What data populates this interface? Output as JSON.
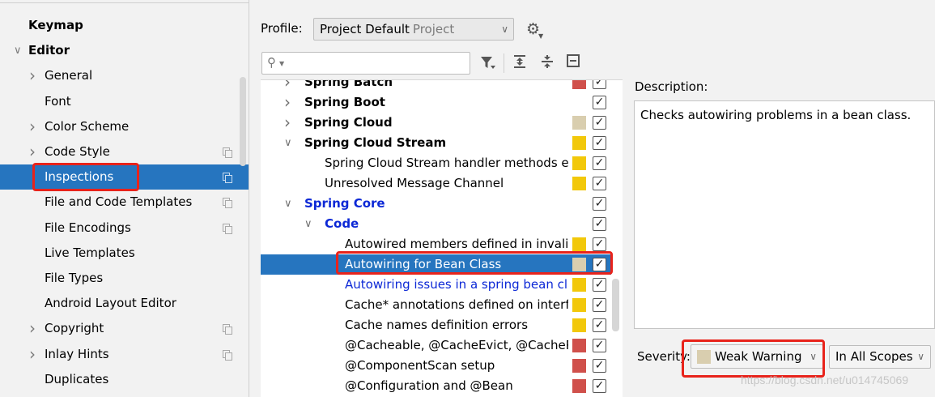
{
  "sidebar": {
    "items": [
      {
        "label": "Keymap",
        "bold": true,
        "indent": 0,
        "chevron": "",
        "copy": false
      },
      {
        "label": "Editor",
        "bold": true,
        "indent": 0,
        "chevron": "down",
        "copy": false
      },
      {
        "label": "General",
        "bold": false,
        "indent": 1,
        "chevron": "right",
        "copy": false
      },
      {
        "label": "Font",
        "bold": false,
        "indent": 1,
        "chevron": "",
        "copy": false
      },
      {
        "label": "Color Scheme",
        "bold": false,
        "indent": 1,
        "chevron": "right",
        "copy": false
      },
      {
        "label": "Code Style",
        "bold": false,
        "indent": 1,
        "chevron": "right",
        "copy": true
      },
      {
        "label": "Inspections",
        "bold": false,
        "indent": 1,
        "chevron": "",
        "copy": true,
        "selected": true
      },
      {
        "label": "File and Code Templates",
        "bold": false,
        "indent": 1,
        "chevron": "",
        "copy": true
      },
      {
        "label": "File Encodings",
        "bold": false,
        "indent": 1,
        "chevron": "",
        "copy": true
      },
      {
        "label": "Live Templates",
        "bold": false,
        "indent": 1,
        "chevron": "",
        "copy": false
      },
      {
        "label": "File Types",
        "bold": false,
        "indent": 1,
        "chevron": "",
        "copy": false
      },
      {
        "label": "Android Layout Editor",
        "bold": false,
        "indent": 1,
        "chevron": "",
        "copy": false
      },
      {
        "label": "Copyright",
        "bold": false,
        "indent": 1,
        "chevron": "right",
        "copy": true
      },
      {
        "label": "Inlay Hints",
        "bold": false,
        "indent": 1,
        "chevron": "right",
        "copy": true
      },
      {
        "label": "Duplicates",
        "bold": false,
        "indent": 1,
        "chevron": "",
        "copy": false
      }
    ]
  },
  "profile": {
    "label": "Profile:",
    "value": "Project Default",
    "value_suffix": "Project",
    "gear_icon": "gear-icon"
  },
  "toolbar": {
    "search_placeholder": "",
    "icons": [
      "filter-icon",
      "expand-all-icon",
      "collapse-all-icon",
      "reset-icon"
    ]
  },
  "tree": {
    "rows": [
      {
        "label": "Spring Batch",
        "style": "bold",
        "level": 0,
        "chevron": "right",
        "severity_color": "#d0504b",
        "checked": true
      },
      {
        "label": "Spring Boot",
        "style": "bold",
        "level": 0,
        "chevron": "right",
        "severity_color": "",
        "checked": true
      },
      {
        "label": "Spring Cloud",
        "style": "bold",
        "level": 0,
        "chevron": "right",
        "severity_color": "#d9ceaf",
        "checked": true
      },
      {
        "label": "Spring Cloud Stream",
        "style": "bold",
        "level": 0,
        "chevron": "down",
        "severity_color": "#f2c80a",
        "checked": true
      },
      {
        "label": "Spring Cloud Stream handler methods errors",
        "style": "normal",
        "level": 1,
        "chevron": "",
        "severity_color": "#f2c80a",
        "checked": true
      },
      {
        "label": "Unresolved Message Channel",
        "style": "normal",
        "level": 1,
        "chevron": "",
        "severity_color": "#f2c80a",
        "checked": true
      },
      {
        "label": "Spring Core",
        "style": "bold-blue",
        "level": 0,
        "chevron": "down",
        "severity_color": "",
        "checked": true
      },
      {
        "label": "Code",
        "style": "bold-blue",
        "level": 1,
        "chevron": "down",
        "severity_color": "",
        "checked": true
      },
      {
        "label": "Autowired members defined in invalid",
        "style": "normal",
        "level": 2,
        "chevron": "",
        "severity_color": "#f2c80a",
        "checked": true
      },
      {
        "label": "Autowiring for Bean Class",
        "style": "normal",
        "level": 2,
        "chevron": "",
        "severity_color": "#d9ceaf",
        "checked": true,
        "selected": true
      },
      {
        "label": "Autowiring issues in a spring bean class",
        "style": "blue",
        "level": 2,
        "chevron": "",
        "severity_color": "#f2c80a",
        "checked": true
      },
      {
        "label": "Cache* annotations defined on interface",
        "style": "normal",
        "level": 2,
        "chevron": "",
        "severity_color": "#f2c80a",
        "checked": true
      },
      {
        "label": "Cache names definition errors",
        "style": "normal",
        "level": 2,
        "chevron": "",
        "severity_color": "#f2c80a",
        "checked": true
      },
      {
        "label": "@Cacheable, @CacheEvict, @CachePut",
        "style": "normal",
        "level": 2,
        "chevron": "",
        "severity_color": "#d0504b",
        "checked": true
      },
      {
        "label": "@ComponentScan setup",
        "style": "normal",
        "level": 2,
        "chevron": "",
        "severity_color": "#d0504b",
        "checked": true
      },
      {
        "label": "@Configuration and @Bean",
        "style": "normal",
        "level": 2,
        "chevron": "",
        "severity_color": "#d0504b",
        "checked": true
      }
    ]
  },
  "description": {
    "label": "Description:",
    "text": "Checks autowiring problems in a bean class."
  },
  "severity": {
    "label": "Severity:",
    "value": "Weak Warning",
    "color": "#d9ceaf",
    "scope": "In All Scopes"
  },
  "watermark": "https://blog.csdn.net/u014745069",
  "colors": {
    "selection": "#2675bf",
    "highlight_box": "#e8231b",
    "link_blue": "#0c28d6"
  }
}
